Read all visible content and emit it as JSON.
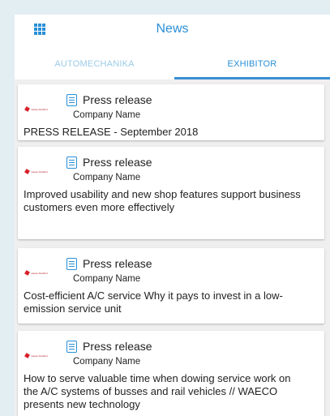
{
  "header": {
    "title": "News",
    "menu_icon": "grid-apps-icon",
    "accent": "#2a8fd6"
  },
  "tabs": [
    {
      "label": "AUTOMECHANIKA",
      "active": false
    },
    {
      "label": "EXHIBITOR",
      "active": true
    }
  ],
  "items": [
    {
      "type_label": "Press release",
      "company": "Company Name",
      "headline": "PRESS RELEASE - September 2018"
    },
    {
      "type_label": "Press release",
      "company": "Company Name",
      "headline": "Improved usability and new shop features support business customers even more effectively"
    },
    {
      "type_label": "Press release",
      "company": "Company Name",
      "headline": "Cost-efficient A/C service Why it pays to invest in a low-emission service unit"
    },
    {
      "type_label": "Press release",
      "company": "Company Name",
      "headline": "How to serve valuable time when dowing service work on the A/C systems of busses and rail vehicles // WAECO presents new technology"
    }
  ]
}
